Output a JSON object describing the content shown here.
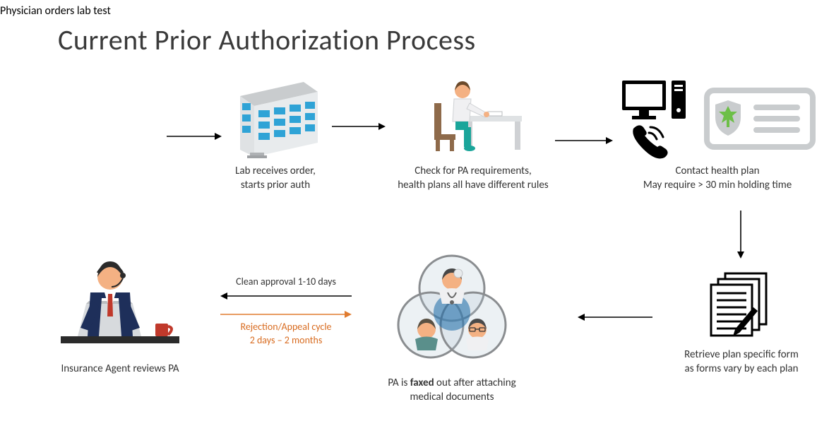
{
  "title": "Current Prior Authorization Process",
  "steps": {
    "s1": {
      "caption": "Physician orders lab test"
    },
    "s2": {
      "caption_l1": "Lab receives order,",
      "caption_l2": "starts prior auth"
    },
    "s3": {
      "caption_l1": "Check for PA requirements,",
      "caption_l2": "health plans all have different rules"
    },
    "s4": {
      "caption_l1": "Contact health plan",
      "caption_l2": "May require > 30 min holding time"
    },
    "s5": {
      "caption_l1": "Retrieve plan specific form",
      "caption_l2": "as forms vary by each plan"
    },
    "s6": {
      "caption_prefix": "PA is ",
      "caption_bold": "faxed",
      "caption_suffix": " out after attaching",
      "caption_l2": "medical documents"
    },
    "s7": {
      "caption": "Insurance Agent reviews PA"
    }
  },
  "paths": {
    "approval": "Clean approval 1-10 days",
    "rejection_l1": "Rejection/Appeal cycle",
    "rejection_l2": "2 days – 2 months"
  },
  "colors": {
    "teal": "#1aa59a",
    "skin": "#f4b183",
    "hair": "#6b4a2b",
    "coat": "#f0f0f2",
    "blue_glass": "#2fa3d6",
    "dark": "#303030",
    "orange": "#e07b2f",
    "grey": "#b9bcbf",
    "red": "#c0392b",
    "green_med": "#6dbf47",
    "navy": "#1e2f5a"
  }
}
